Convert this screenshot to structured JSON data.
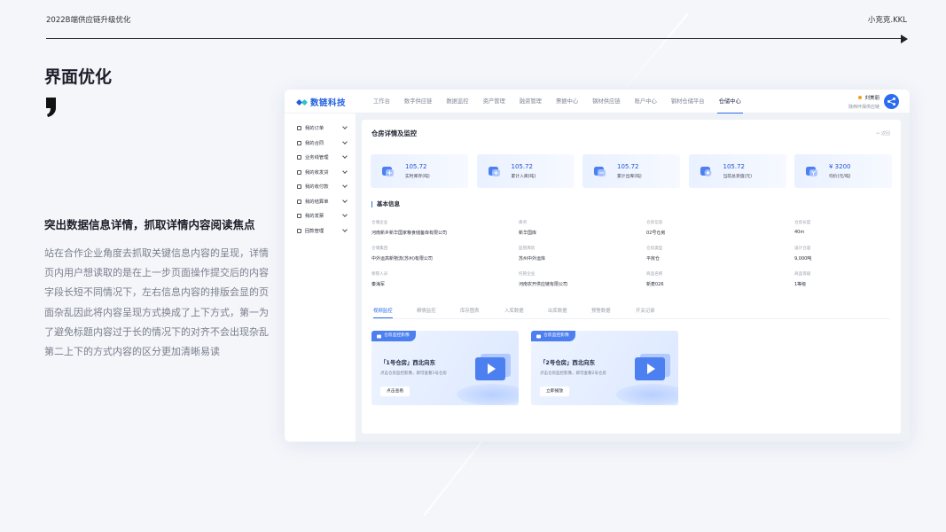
{
  "slide": {
    "header_left": "2022B端供应链升级优化",
    "header_right": "小克克.KKL",
    "title": "界面优化",
    "section_heading": "突出数据信息详情，抓取详情内容阅读焦点",
    "paragraph_lines": [
      "站在合作企业角度去抓取关键信息内容的呈现，详情",
      "页内用户想读取的是在上一步页面操作提交后的内容",
      "字段长短不同情况下，左右信息内容的排版会显的页",
      "面杂乱因此将内容呈现方式换成了上下方式，第一为",
      "了避免标题内容过于长的情况下的对齐不会出现杂乱",
      "第二上下的方式内容的区分更加清晰易读"
    ]
  },
  "app": {
    "logo_text": "数链科技",
    "logo_colors": [
      "#1f5fe0",
      "#2ec4c4"
    ],
    "nav": [
      "工作台",
      "数字供应链",
      "数据监控",
      "资产管理",
      "融资管理",
      "票据中心",
      "钢材供应链",
      "账户中心",
      "钢材仓储平台",
      "仓储中心"
    ],
    "nav_active_index": 9,
    "user": {
      "name": "刘美丽",
      "company": "陕西环保供应链"
    },
    "sidebar": [
      "我的订单",
      "我的合同",
      "业务线管理",
      "我的收发货",
      "我的收付款",
      "我的结算单",
      "我的发票",
      "回款管理"
    ],
    "panel_title": "仓房详情及监控",
    "back_label": "返回",
    "stats": [
      {
        "value": "105.72",
        "label": "实时库存(吨)",
        "icon": "warehouse-icon"
      },
      {
        "value": "105.72",
        "label": "累计入库(吨)",
        "icon": "inbound-icon"
      },
      {
        "value": "105.72",
        "label": "累计出库(吨)",
        "icon": "outbound-icon"
      },
      {
        "value": "105.72",
        "label": "当前总货值(元)",
        "icon": "value-icon"
      },
      {
        "value": "¥ 3200",
        "label": "均价(元/吨)",
        "icon": "price-icon"
      }
    ],
    "basic_title": "基本信息",
    "fields": [
      {
        "k": "仓储企业",
        "v": "河南新乡新华国家粮食储备库有限公司"
      },
      {
        "k": "库点",
        "v": "新华国库"
      },
      {
        "k": "仓房信息",
        "v": "02号仓房"
      },
      {
        "k": "仓房长度",
        "v": "40m"
      },
      {
        "k": "仓储集团",
        "v": "中外运高新物流(苏州)有限公司"
      },
      {
        "k": "监管库房",
        "v": "苏州中外运库"
      },
      {
        "k": "仓房类型",
        "v": "平房仓"
      },
      {
        "k": "设计仓容",
        "v": "9,000吨"
      },
      {
        "k": "保管人员",
        "v": "秦海军"
      },
      {
        "k": "托管企业",
        "v": "河南农开供应链有限公司"
      },
      {
        "k": "商品名称",
        "v": "新麦026"
      },
      {
        "k": "商品等级",
        "v": "1等级"
      }
    ],
    "tabs": [
      "视频监控",
      "粮情监控",
      "库存图表",
      "入库数据",
      "出库数据",
      "预警数据",
      "开关记录"
    ],
    "tab_active_index": 0,
    "cards": [
      {
        "badge": "仓房监控影像",
        "title": "「1号仓房」西北向东",
        "desc": "点击仓房监控影像，即可查看1号仓房",
        "button": "点击查看"
      },
      {
        "badge": "仓房监控影像",
        "title": "「2号仓房」西北向东",
        "desc": "点击仓房监控影像，即可查看2号仓房",
        "button": "立即播放"
      }
    ]
  }
}
